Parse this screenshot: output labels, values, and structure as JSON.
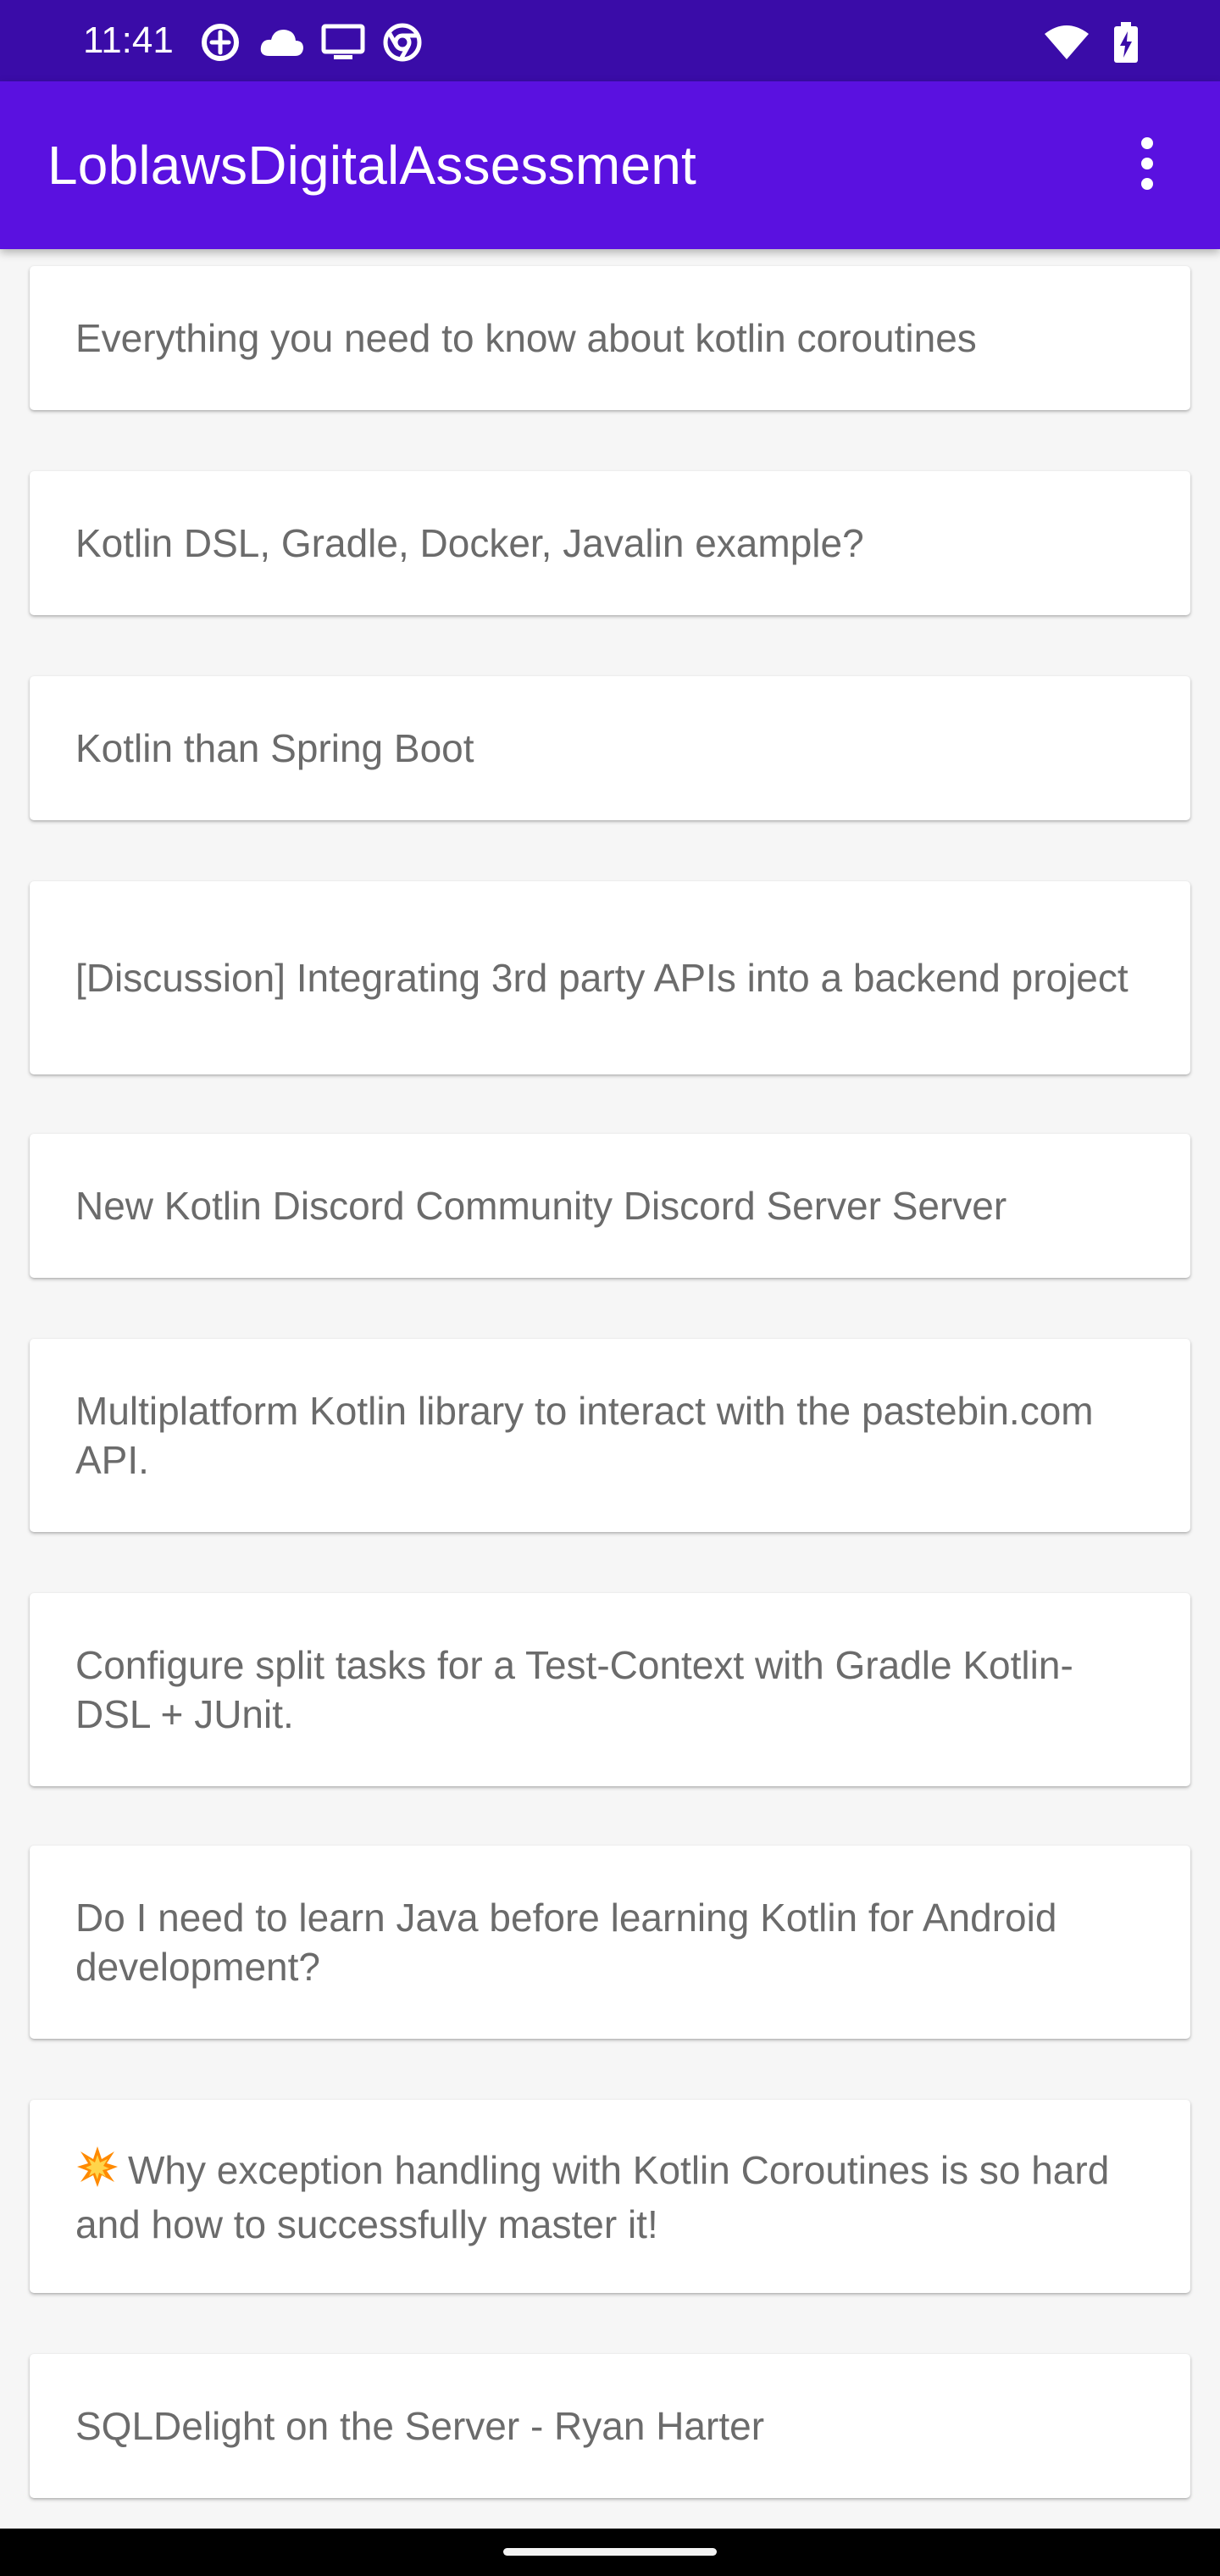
{
  "status_bar": {
    "time": "11:41",
    "left_icons": [
      "data-saver-icon",
      "cloud-icon",
      "cast-screen-icon",
      "chrome-icon"
    ],
    "right_icons": [
      "wifi-icon",
      "battery-charging-icon"
    ],
    "background_color": "#3a0ca8"
  },
  "app_bar": {
    "title": "LoblawsDigitalAssessment",
    "menu_icon": "more-vert-icon",
    "background_color": "#5a11e0"
  },
  "posts": [
    {
      "title": "Everything you need to know about kotlin coroutines"
    },
    {
      "title": "Kotlin DSL, Gradle, Docker, Javalin example?"
    },
    {
      "title": "Kotlin than Spring Boot"
    },
    {
      "title": "[Discussion] Integrating 3rd party APIs into a backend project"
    },
    {
      "title": "New Kotlin Discord Community Discord Server Server"
    },
    {
      "title": "Multiplatform Kotlin library to interact with the pastebin.com API."
    },
    {
      "title": "Configure split tasks for a Test-Context with Gradle Kotlin-DSL + JUnit."
    },
    {
      "title": "Do I need to learn Java before learning Kotlin for Android development?"
    },
    {
      "title": "Why exception handling with Kotlin Coroutines is so hard and how to successfully master it!",
      "icon": "collision-emoji-icon"
    },
    {
      "title": "SQLDelight on the Server - Ryan Harter"
    }
  ],
  "nav_bar": {
    "handle": "gesture-handle"
  }
}
